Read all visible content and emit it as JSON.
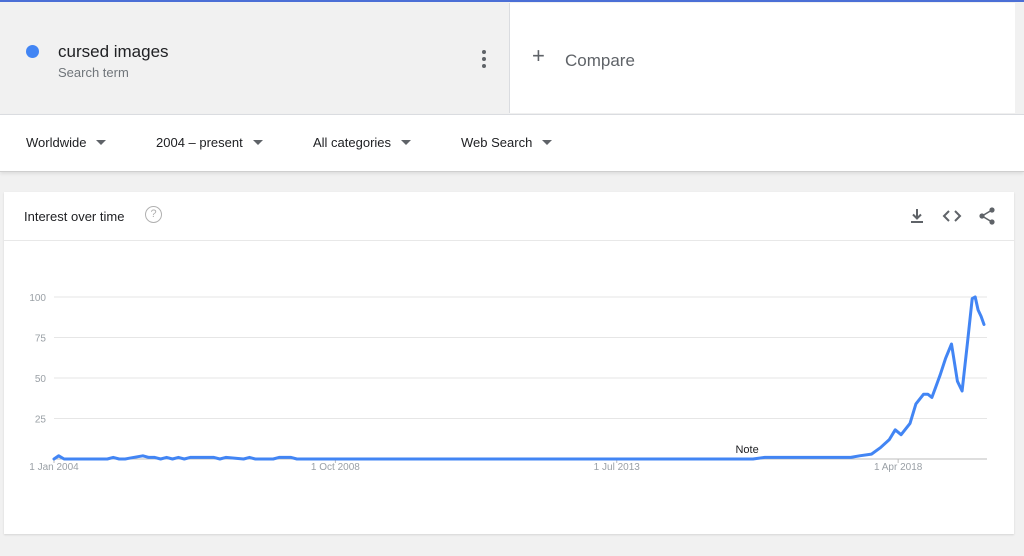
{
  "search_term": {
    "name": "cursed images",
    "subtitle": "Search term",
    "color": "#4285f4"
  },
  "compare": {
    "plus": "+",
    "label": "Compare"
  },
  "filters": {
    "region": "Worldwide",
    "time_range": "2004 – present",
    "category": "All categories",
    "search_type": "Web Search"
  },
  "card": {
    "title": "Interest over time",
    "help": "?",
    "note_label": "Note"
  },
  "icons": [
    "kebab-menu-icon",
    "help-icon",
    "download-icon",
    "embed-code-icon",
    "share-icon"
  ],
  "chart_data": {
    "type": "line",
    "title": "",
    "xlabel": "",
    "ylabel": "",
    "ylim": [
      0,
      100
    ],
    "yticks": [
      25,
      50,
      75,
      100
    ],
    "xticks": [
      "1 Jan 2004",
      "1 Oct 2008",
      "1 Jul 2013",
      "1 Apr 2018"
    ],
    "xtick_years": [
      2004.0,
      2008.75,
      2013.5,
      2018.25
    ],
    "xlim": [
      2004.0,
      2019.75
    ],
    "grid": true,
    "note": {
      "label": "Note",
      "x": 2015.7
    },
    "series": [
      {
        "color": "#4285f4",
        "x": [
          2004.0,
          2004.08,
          2004.17,
          2004.3,
          2004.6,
          2004.9,
          2005.0,
          2005.1,
          2005.2,
          2005.5,
          2005.6,
          2005.7,
          2005.8,
          2005.9,
          2006.0,
          2006.1,
          2006.2,
          2006.3,
          2006.5,
          2006.7,
          2006.8,
          2006.9,
          2007.2,
          2007.3,
          2007.4,
          2007.6,
          2007.7,
          2007.8,
          2008.0,
          2008.1,
          2008.2,
          2008.3,
          2009.0,
          2010.0,
          2011.0,
          2012.0,
          2013.0,
          2014.0,
          2015.0,
          2015.8,
          2016.0,
          2016.5,
          2017.0,
          2017.45,
          2017.6,
          2017.8,
          2017.95,
          2018.1,
          2018.2,
          2018.3,
          2018.45,
          2018.55,
          2018.68,
          2018.75,
          2018.82,
          2018.88,
          2018.96,
          2019.05,
          2019.15,
          2019.25,
          2019.33,
          2019.42,
          2019.5,
          2019.55,
          2019.6,
          2019.65,
          2019.7
        ],
        "y": [
          0,
          2,
          0,
          0,
          0,
          0,
          1,
          0,
          0,
          2,
          1,
          1,
          0,
          1,
          0,
          1,
          0,
          1,
          1,
          1,
          0,
          1,
          0,
          1,
          0,
          0,
          0,
          1,
          1,
          0,
          0,
          0,
          0,
          0,
          0,
          0,
          0,
          0,
          0,
          0,
          1,
          1,
          1,
          1,
          2,
          3,
          7,
          12,
          18,
          15,
          22,
          34,
          40,
          40,
          38,
          44,
          52,
          62,
          71,
          48,
          42,
          72,
          99,
          100,
          92,
          88,
          83
        ]
      }
    ]
  }
}
